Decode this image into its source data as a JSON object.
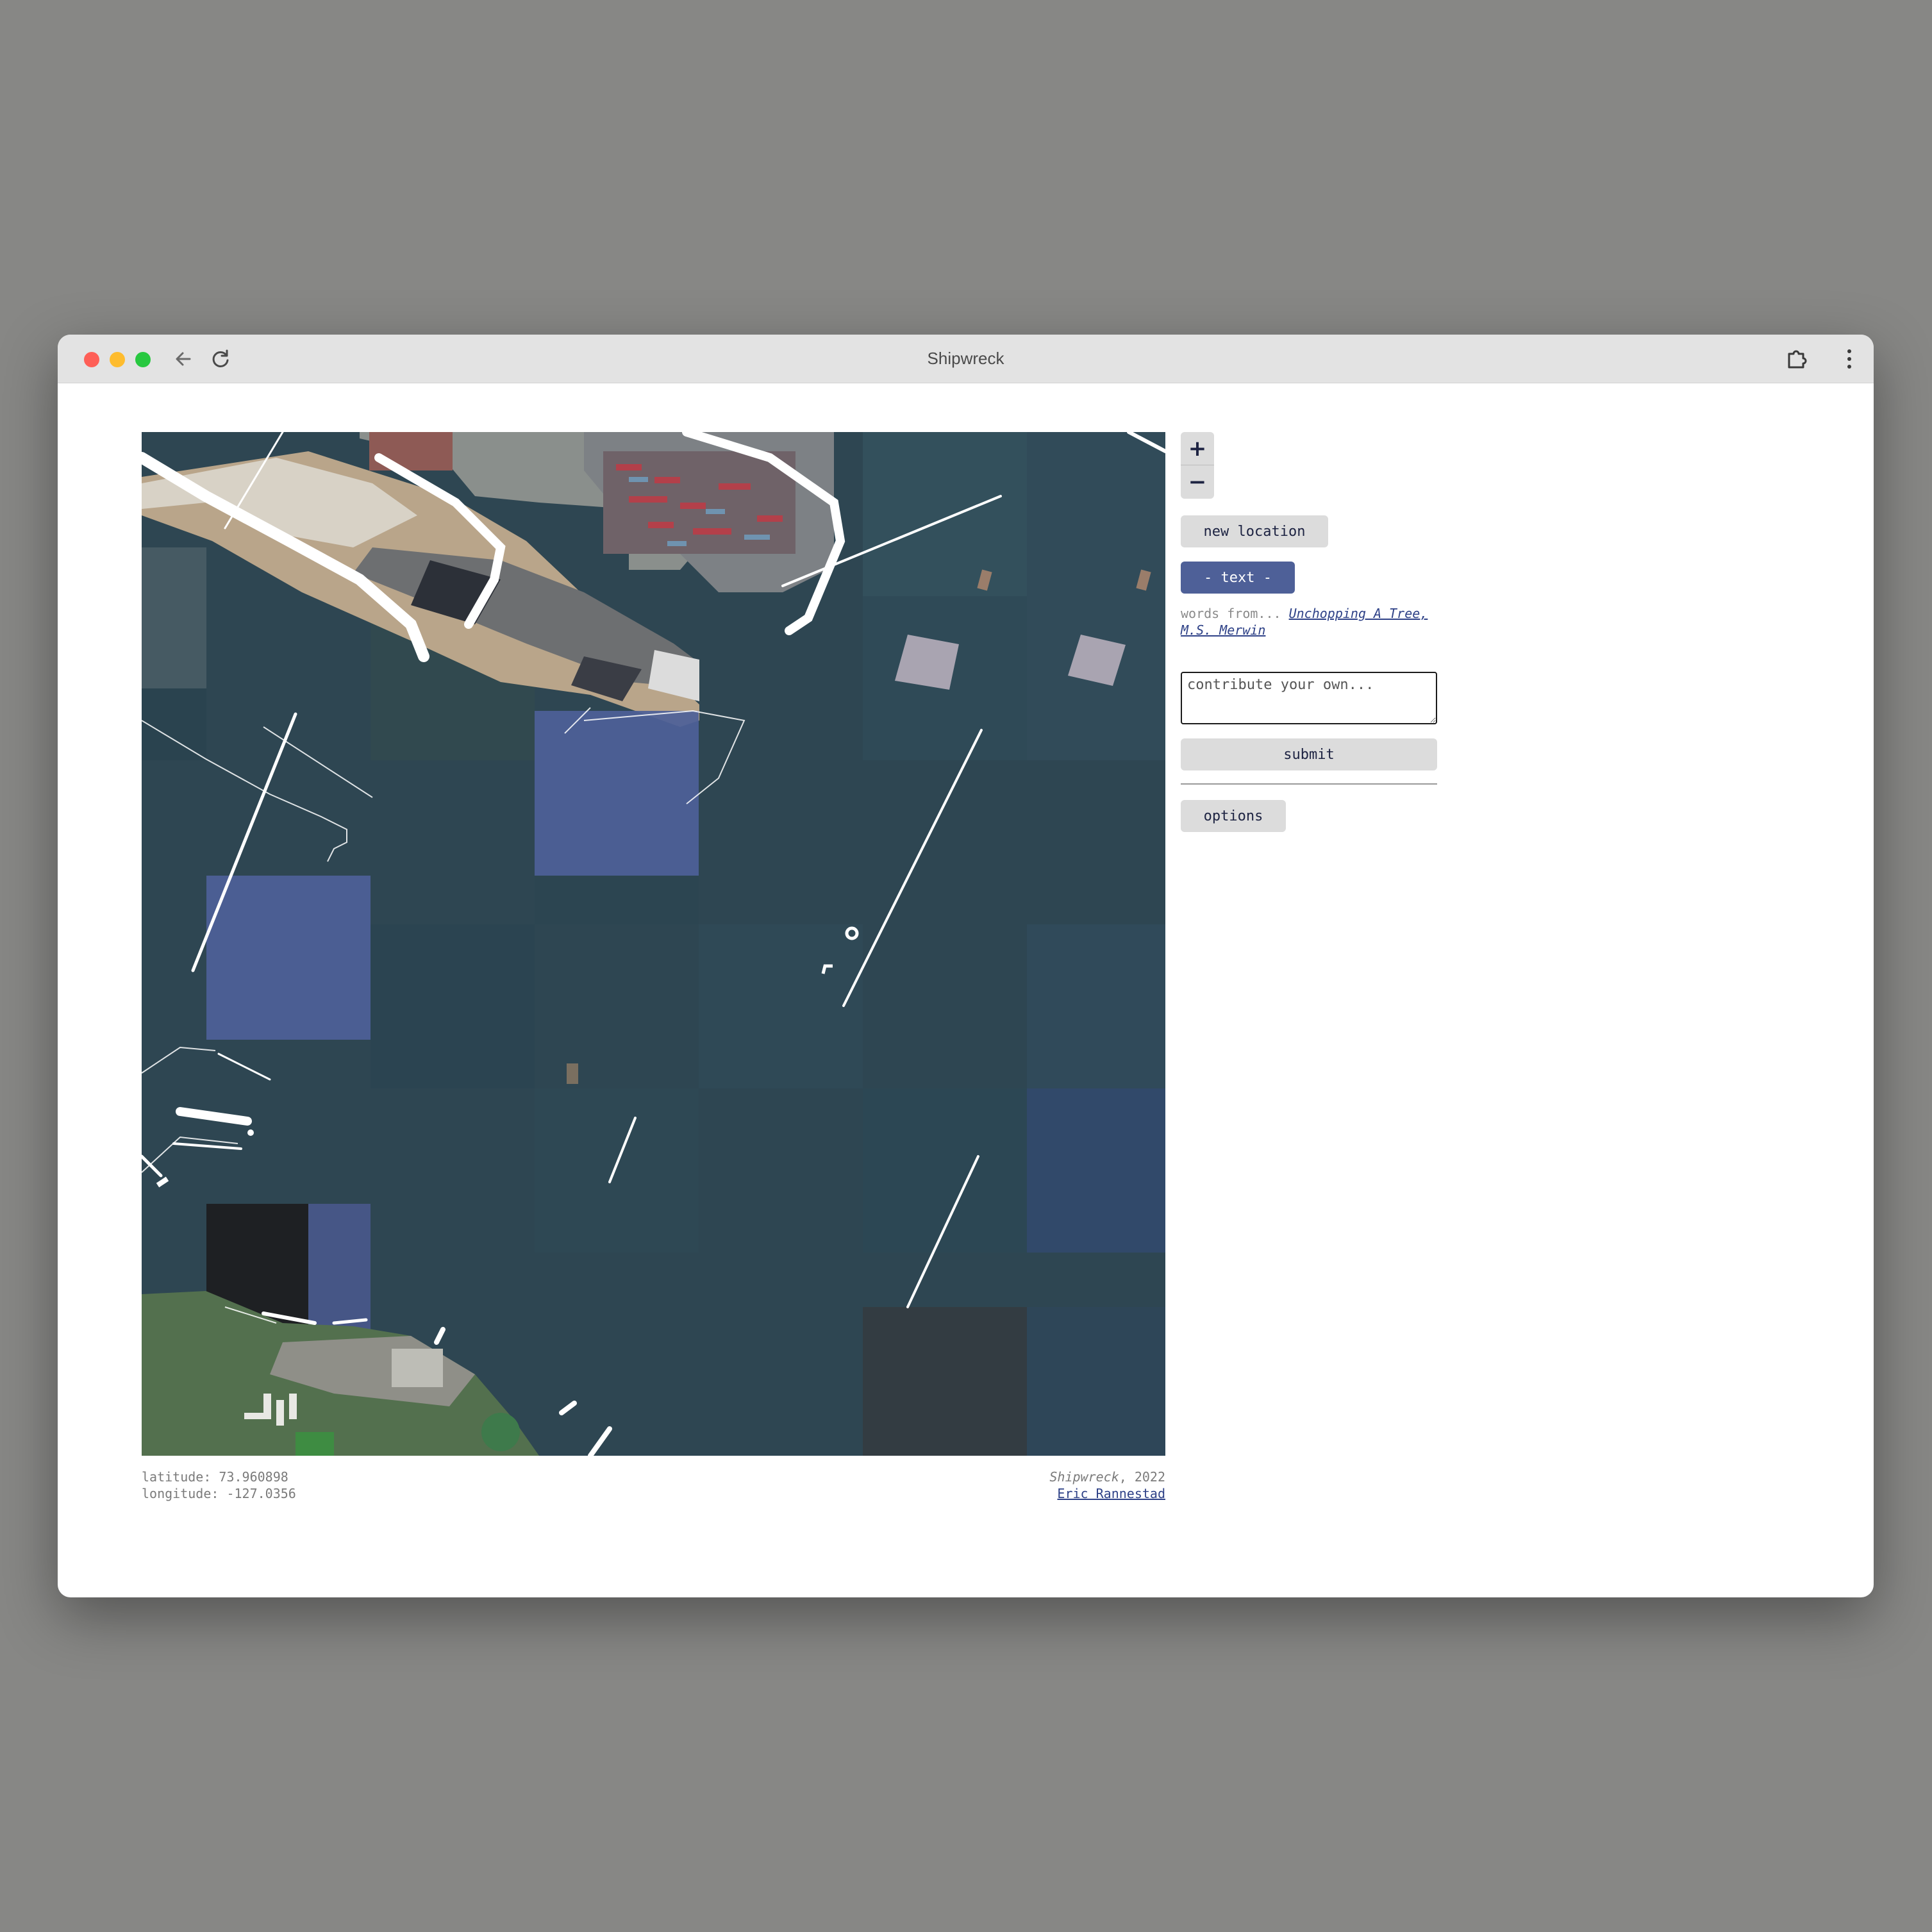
{
  "browser": {
    "title": "Shipwreck",
    "icons": [
      "back-arrow-icon",
      "reload-icon",
      "extension-icon",
      "menu-dots-icon"
    ]
  },
  "map": {
    "view": "satellite imagery of a harbor with container terminal, shipping lanes and shoreline",
    "accent": "#4e6098"
  },
  "controls": {
    "zoom_in": "+",
    "zoom_out": "−",
    "new_location": "new location",
    "text_toggle": "- text -",
    "words_prefix": "words from...",
    "words_source": "Unchopping A Tree, M.S. Merwin",
    "contribute_placeholder": "contribute your own...",
    "submit": "submit",
    "options": "options"
  },
  "location": {
    "latitude_label": "latitude:",
    "latitude": "73.960898",
    "longitude_label": "longitude:",
    "longitude": "-127.0356"
  },
  "credit": {
    "work": "Shipwreck",
    "year": ", 2022",
    "author": "Eric Rannestad"
  }
}
